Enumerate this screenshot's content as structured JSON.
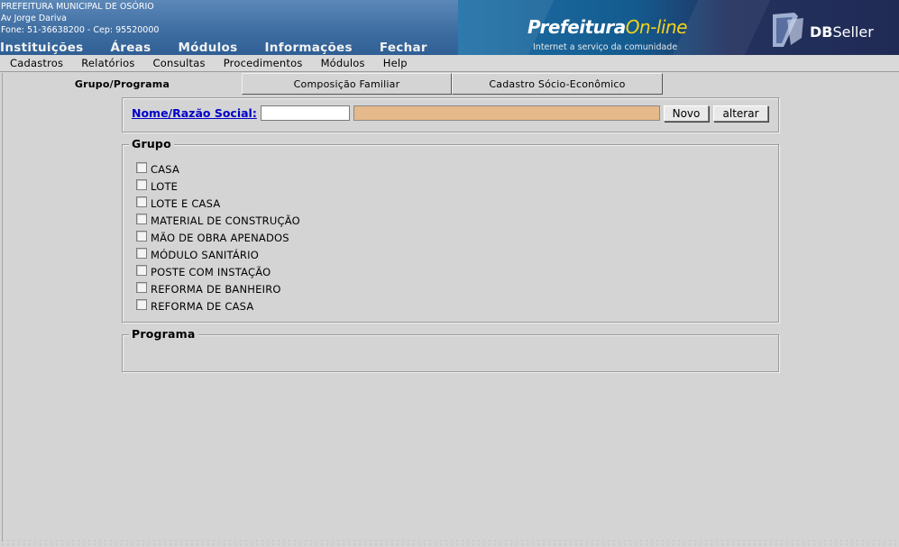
{
  "header": {
    "institution": "PREFEITURA MUNICIPAL DE OSÓRIO",
    "address": "Av Jorge Dariva",
    "contact": "Fone: 51-36638200  -  Cep: 95520000",
    "nav": [
      "Instituições",
      "Áreas",
      "Módulos",
      "Informações",
      "Fechar"
    ],
    "brand_word1": "Prefeitura",
    "brand_word2": "On-line",
    "brand_tagline": "Internet a serviço da comunidade",
    "dbseller_bold": "DB",
    "dbseller_rest": "Seller"
  },
  "menubar": [
    "Cadastros",
    "Relatórios",
    "Consultas",
    "Procedimentos",
    "Módulos",
    "Help"
  ],
  "tabs": {
    "active": "Grupo/Programa",
    "composicao": "Composição Familiar",
    "cadastro": "Cadastro Sócio-Econômico"
  },
  "form": {
    "name_label": "Nome/Razão Social:",
    "name_input_value": "",
    "name_display_value": "",
    "novo_label": "Novo",
    "alterar_label": "alterar"
  },
  "grupo": {
    "legend": "Grupo",
    "items": [
      "CASA",
      "LOTE",
      "LOTE E CASA",
      "MATERIAL DE CONSTRUÇÃO",
      "MÃO DE OBRA APENADOS",
      "MÓDULO SANITÁRIO",
      "POSTE COM INSTAÇÃO",
      "REFORMA DE BANHEIRO",
      "REFORMA DE CASA"
    ]
  },
  "programa": {
    "legend": "Programa"
  },
  "colors": {
    "header_blue": "#3f6ea2",
    "link_blue": "#0000c8",
    "readonly_field": "#e6b98a",
    "background": "#d4d4d4"
  }
}
